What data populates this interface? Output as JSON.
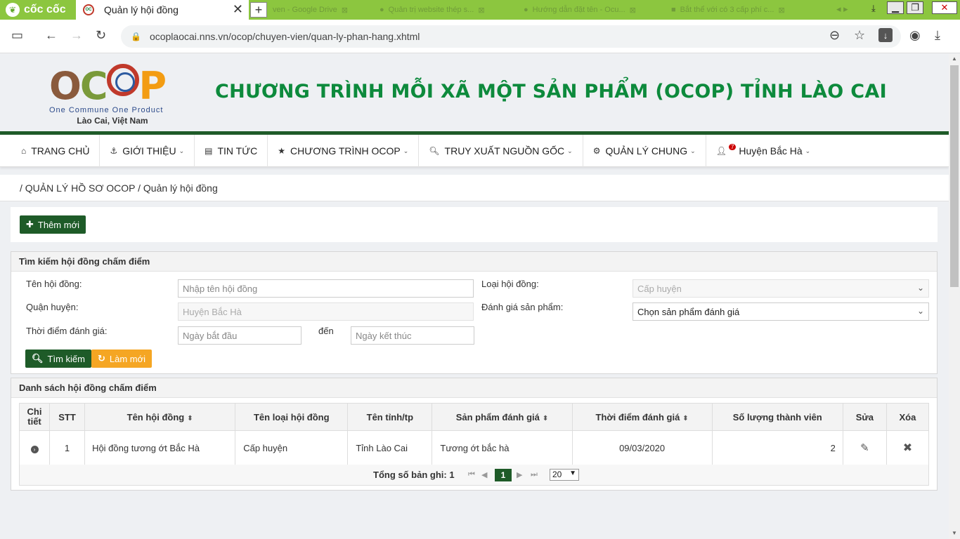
{
  "browser": {
    "brand": "cốc cốc",
    "active_tab_title": "Quản lý hội đồng",
    "background_tabs": [
      "ven - Google Drive",
      "Quản trị website thép s...",
      "Hướng dẫn đặt tên - Ocu...",
      "Bắt thể với có 3 cấp phí c..."
    ],
    "url": "ocoplaocai.nns.vn/ocop/chuyen-vien/quan-ly-phan-hang.xhtml"
  },
  "header": {
    "logo_word": "OCOP",
    "logo_tagline": "One Commune One Product",
    "logo_location": "Lào Cai, Việt Nam",
    "site_title": "CHƯƠNG TRÌNH MỖI XÃ MỘT SẢN PHẨM (OCOP) TỈNH LÀO CAI"
  },
  "menu": {
    "items": [
      {
        "label": "TRANG CHỦ",
        "icon": "home-icon"
      },
      {
        "label": "GIỚI THIỆU",
        "icon": "anchor-icon"
      },
      {
        "label": "TIN TỨC",
        "icon": "newspaper-icon"
      },
      {
        "label": "CHƯƠNG TRÌNH OCOP",
        "icon": "star-icon"
      },
      {
        "label": "TRUY XUẤT NGUỒN GỐC",
        "icon": "search-icon"
      },
      {
        "label": "QUẢN LÝ CHUNG",
        "icon": "gear-icon"
      },
      {
        "label": "Huyện Bắc Hà",
        "icon": "user-icon",
        "badge": "7"
      }
    ]
  },
  "breadcrumb": "/ QUẢN LÝ HỒ SƠ OCOP / Quản lý hội đồng",
  "actions": {
    "add_label": "Thêm mới"
  },
  "search_panel": {
    "title": "Tìm kiếm hội đồng chấm điểm",
    "name_label": "Tên hội đồng:",
    "name_placeholder": "Nhập tên hội đồng",
    "type_label": "Loại hội đồng:",
    "type_value": "Cấp huyện",
    "district_label": "Quận huyện:",
    "district_value": "Huyện Bắc Hà",
    "product_label": "Đánh giá sản phẩm:",
    "product_value": "Chọn sản phẩm đánh giá",
    "time_label": "Thời điểm đánh giá:",
    "start_placeholder": "Ngày bắt đầu",
    "to_label": "đến",
    "end_placeholder": "Ngày kết thúc",
    "search_button": "Tìm kiếm",
    "reset_button": "Làm mới"
  },
  "list_panel": {
    "title": "Danh sách hội đồng chấm điểm",
    "columns": [
      "Chi tiết",
      "STT",
      "Tên hội đồng",
      "Tên loại hội đồng",
      "Tên tỉnh/tp",
      "Sản phẩm đánh giá",
      "Thời điểm đánh giá",
      "Số lượng thành viên",
      "Sửa",
      "Xóa"
    ],
    "rows": [
      {
        "stt": "1",
        "name": "Hội đồng tương ớt Bắc Hà",
        "type": "Cấp huyện",
        "province": "Tỉnh Lào Cai",
        "product": "Tương ớt bắc hà",
        "date": "09/03/2020",
        "members": "2"
      }
    ],
    "total_label": "Tổng số bản ghi: 1",
    "current_page": "1",
    "page_size": "20"
  }
}
